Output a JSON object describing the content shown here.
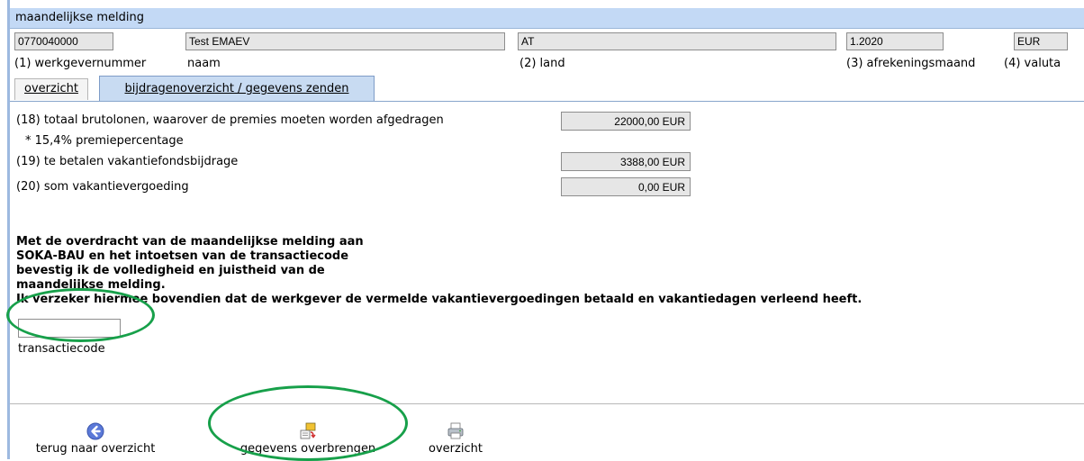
{
  "window": {
    "title": "maandelijkse melding"
  },
  "header": {
    "werkgevernummer": {
      "value": "0770040000",
      "label": "(1) werkgevernummer"
    },
    "naam": {
      "value": "Test EMAEV",
      "label": "naam"
    },
    "land": {
      "value": "AT",
      "label": "(2) land"
    },
    "afrekeningsmaand": {
      "value": "1.2020",
      "label": "(3) afrekeningsmaand"
    },
    "valuta": {
      "value": "EUR",
      "label": "(4) valuta"
    }
  },
  "tabs": [
    {
      "label": "overzicht",
      "active": false
    },
    {
      "label": "bijdragenoverzicht / gegevens zenden",
      "active": true
    }
  ],
  "rows": {
    "brutolonen": {
      "label": "(18) totaal brutolonen, waarover de premies moeten worden afgedragen",
      "value": "22000,00 EUR"
    },
    "premiepercentage": {
      "label": "* 15,4% premiepercentage"
    },
    "vakantiefonds": {
      "label": "(19) te betalen vakantiefondsbijdrage",
      "value": "3388,00 EUR"
    },
    "vakantievergoeding": {
      "label": "(20) som vakantievergoeding",
      "value": "0,00 EUR"
    }
  },
  "declaration": {
    "lines": [
      "Met de overdracht van de maandelijkse melding aan",
      "SOKA-BAU en het intoetsen van de transactiecode",
      "bevestig ik de volledigheid en juistheid van de",
      "maandelijkse melding.",
      "Ik verzeker hiermee bovendien dat de werkgever de vermelde vakantievergoedingen betaald  en vakantiedagen verleend heeft."
    ]
  },
  "transactiecode": {
    "value": "",
    "label": "transactiecode"
  },
  "actions": [
    {
      "label": "terug naar overzicht",
      "icon": "back-arrow-icon"
    },
    {
      "label": "gegevens overbrengen",
      "icon": "transfer-data-icon"
    },
    {
      "label": "overzicht",
      "icon": "printer-icon"
    }
  ],
  "colors": {
    "title_bar": "#c3d9f5",
    "active_tab": "#c8dbf2",
    "highlight_circle": "#17a04a",
    "field_bg": "#e6e6e6"
  }
}
